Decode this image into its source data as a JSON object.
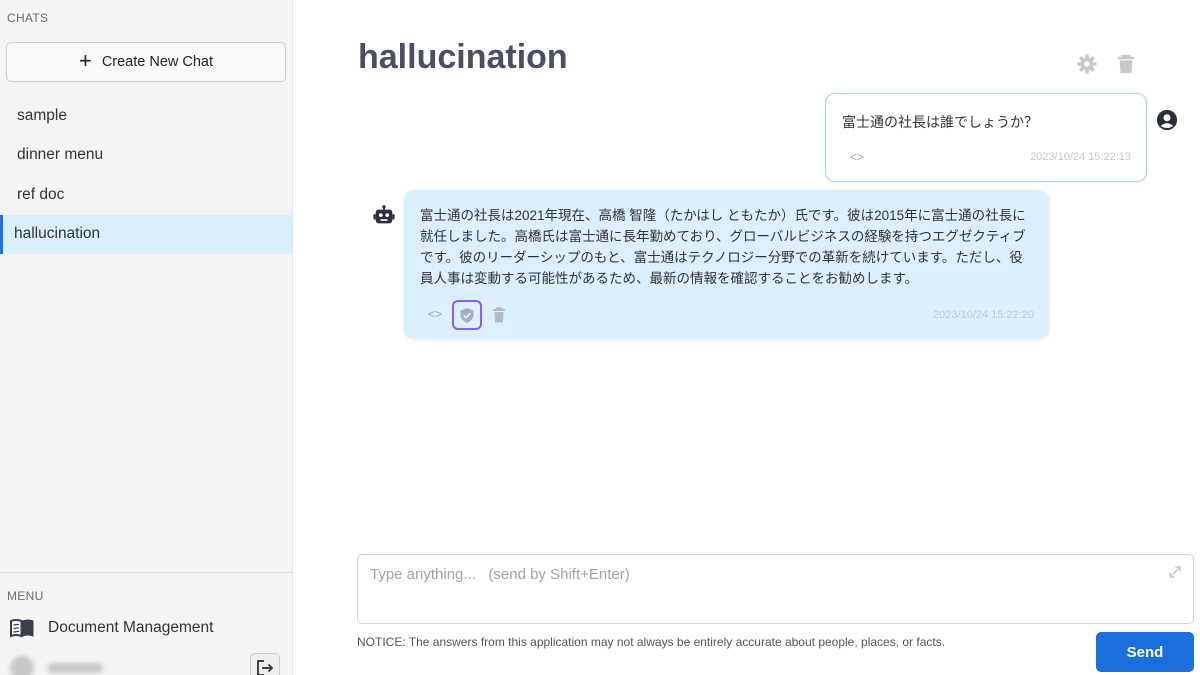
{
  "sidebar": {
    "chats_label": "CHATS",
    "new_chat_label": "Create New Chat",
    "chats": [
      {
        "label": "sample"
      },
      {
        "label": "dinner menu"
      },
      {
        "label": "ref doc"
      },
      {
        "label": "hallucination",
        "active": true
      }
    ],
    "menu_label": "MENU",
    "menu_items": [
      {
        "label": "Document Management",
        "icon": "book-icon"
      }
    ]
  },
  "main": {
    "title": "hallucination",
    "messages": [
      {
        "role": "user",
        "text": "富士通の社長は誰でしょうか？",
        "code_toggle": "<>",
        "time": "2023/10/24 15:22:13"
      },
      {
        "role": "assistant",
        "text": "富士通の社長は2021年現在、高橋 智隆（たかはし ともたか）氏です。彼は2015年に富士通の社長に就任しました。高橋氏は富士通に長年勤めており、グローバルビジネスの経験を持つエグゼクティブです。彼のリーダーシップのもと、富士通はテクノロジー分野での革新を続けています。ただし、役員人事は変動する可能性があるため、最新の情報を確認することをお勧めします。",
        "code_toggle": "<>",
        "time": "2023/10/24 15:22:20"
      }
    ],
    "input": {
      "placeholder": "Type anything...   (send by Shift+Enter)",
      "value": ""
    },
    "notice": "NOTICE: The answers from this application may not always be entirely accurate about people, places, or facts.",
    "send_label": "Send"
  },
  "colors": {
    "accent": "#1a6fdc",
    "active_chat_bg": "#dbeefc",
    "bot_bubble": "#dcefff",
    "verify_outline": "#8b5cf6"
  }
}
